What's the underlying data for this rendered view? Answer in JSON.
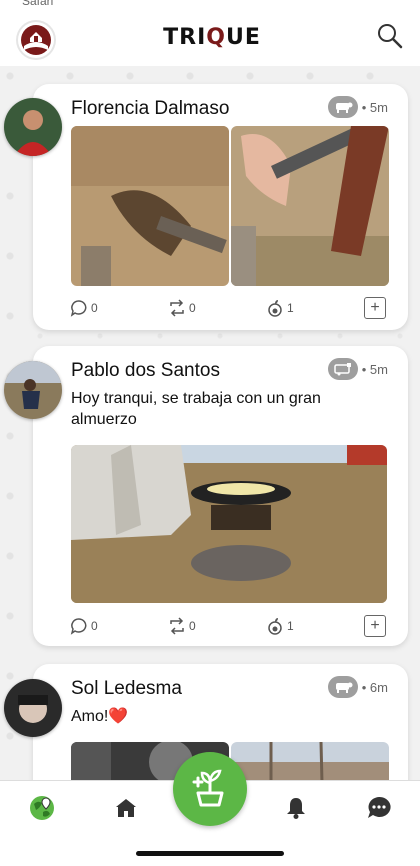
{
  "status": {
    "carrier_clipped": "Safari"
  },
  "app": {
    "logo_left": "TRI",
    "logo_q": "Q",
    "logo_right": "UE"
  },
  "posts": [
    {
      "author": "Florencia Dalmaso",
      "time": "• 5m",
      "category_icon": "cow-icon",
      "text": "",
      "comments": "0",
      "reposts": "0",
      "likes": "1"
    },
    {
      "author": "Pablo  dos Santos",
      "time": "• 5m",
      "category_icon": "machine-icon",
      "text": "Hoy tranqui, se trabaja con un gran almuerzo",
      "comments": "0",
      "reposts": "0",
      "likes": "1"
    },
    {
      "author": "Sol Ledesma",
      "time": "• 6m",
      "category_icon": "cow-icon",
      "text": "Amo!❤️"
    }
  ],
  "nav": {
    "items": [
      "map-icon",
      "home-icon",
      "new-post-icon",
      "bell-icon",
      "chat-icon"
    ]
  },
  "colors": {
    "brand_green": "#5cb746",
    "brand_red": "#7a1a1a",
    "badge_gray": "#9e9e9e"
  }
}
